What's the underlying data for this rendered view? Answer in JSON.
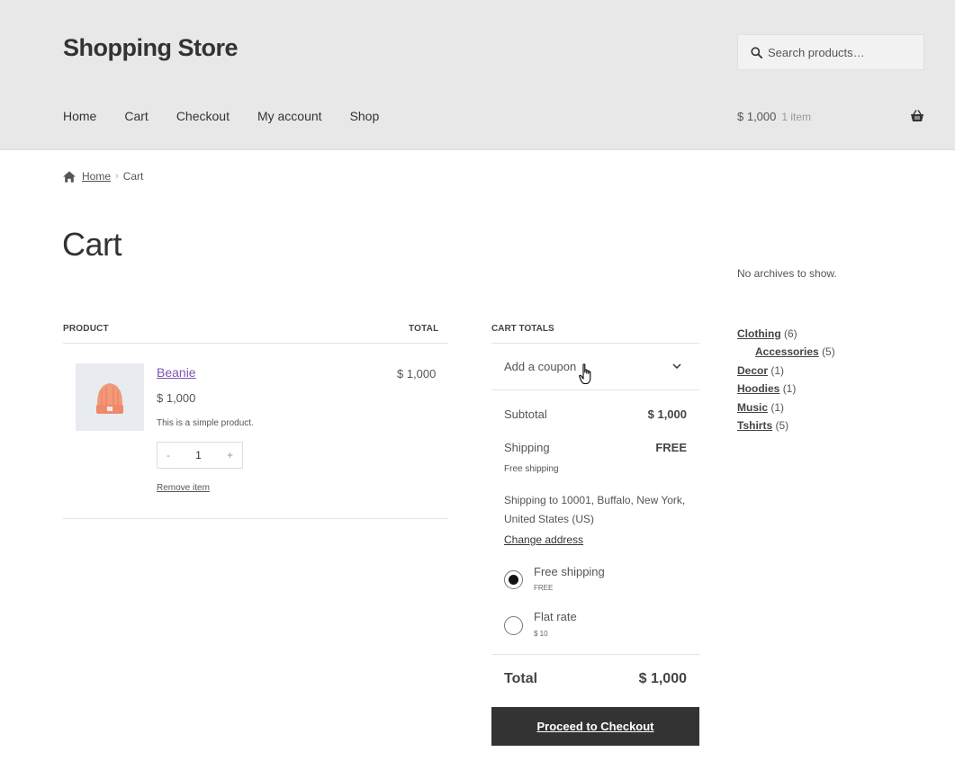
{
  "header": {
    "site_title": "Shopping Store",
    "search_placeholder": "Search products…",
    "nav": [
      "Home",
      "Cart",
      "Checkout",
      "My account",
      "Shop"
    ],
    "mini_cart_amount": "$ 1,000",
    "mini_cart_count": "1 item"
  },
  "breadcrumb": {
    "home": "Home",
    "current": "Cart"
  },
  "page_title": "Cart",
  "cart_table": {
    "col_product": "PRODUCT",
    "col_total": "TOTAL",
    "item": {
      "name": "Beanie",
      "price": "$ 1,000",
      "description": "This is a simple product.",
      "qty_minus": "-",
      "quantity": "1",
      "qty_plus": "+",
      "remove": "Remove item",
      "line_total": "$ 1,000"
    }
  },
  "cart_totals": {
    "title": "CART TOTALS",
    "coupon": "Add a coupon",
    "subtotal_label": "Subtotal",
    "subtotal_value": "$ 1,000",
    "shipping_label": "Shipping",
    "shipping_value": "FREE",
    "shipping_method": "Free shipping",
    "shipping_to": "Shipping to 10001, Buffalo, New York, United States (US)",
    "change_address": "Change address",
    "options": [
      {
        "label": "Free shipping",
        "sub": "FREE",
        "selected": true
      },
      {
        "label": "Flat rate",
        "sub": "$ 10",
        "selected": false
      }
    ],
    "total_label": "Total",
    "total_value": "$ 1,000",
    "checkout_button": "Proceed to Checkout"
  },
  "sidebar": {
    "archives_text": "No archives to show.",
    "categories": [
      {
        "name": "Clothing",
        "count": "(6)"
      },
      {
        "name": "Accessories",
        "count": "(5)"
      },
      {
        "name": "Decor",
        "count": "(1)"
      },
      {
        "name": "Hoodies",
        "count": "(1)"
      },
      {
        "name": "Music",
        "count": "(1)"
      },
      {
        "name": "Tshirts",
        "count": "(5)"
      }
    ]
  },
  "colors": {
    "header_bg": "#e8e8e8",
    "link_purple": "#7f54b3",
    "button_bg": "#333333"
  }
}
